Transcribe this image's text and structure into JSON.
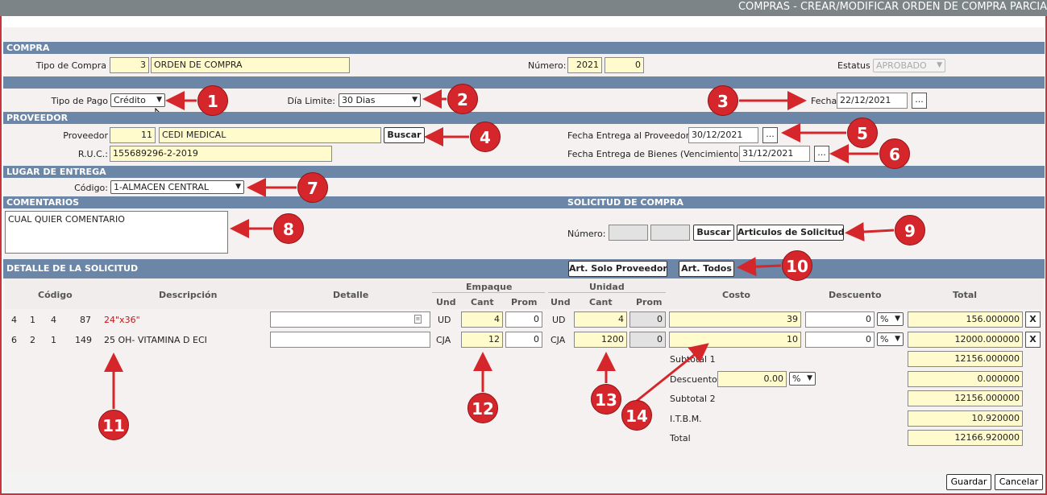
{
  "window": {
    "title": "COMPRAS - CREAR/MODIFICAR ORDEN DE COMPRA PARCIA"
  },
  "compra": {
    "section": "COMPRA",
    "tipo_label": "Tipo de Compra",
    "tipo_code": "3",
    "tipo_name": "ORDEN DE COMPRA",
    "numero_label": "Número:",
    "numero_year": "2021",
    "numero_seq": "0",
    "estatus_label": "Estatus",
    "estatus_value": "APROBADO"
  },
  "pago": {
    "tipo_label": "Tipo de Pago",
    "tipo_value": "Crédito",
    "dia_label": "Día Limite:",
    "dia_value": "30 Dias",
    "fecha_label": "Fecha",
    "fecha_value": "22/12/2021",
    "dots": "..."
  },
  "proveedor": {
    "section": "PROVEEDOR",
    "label": "Proveedor",
    "code": "11",
    "name": "CEDI MEDICAL",
    "buscar": "Buscar",
    "ruc_label": "R.U.C.:",
    "ruc_value": "155689296-2-2019",
    "fe_prov_label": "Fecha Entrega al Proveedor",
    "fe_prov_value": "30/12/2021",
    "fe_bienes_label": "Fecha Entrega de Bienes (Vencimiento)",
    "fe_bienes_value": "31/12/2021"
  },
  "lugar": {
    "section": "LUGAR DE ENTREGA",
    "codigo_label": "Código:",
    "codigo_value": "1-ALMACEN CENTRAL"
  },
  "comentarios": {
    "section": "COMENTARIOS",
    "text": "CUAL QUIER COMENTARIO"
  },
  "solicitud": {
    "section": "SOLICITUD DE COMPRA",
    "numero_label": "Número:",
    "buscar": "Buscar",
    "articulos": "Articulos de Solicitud"
  },
  "detalle": {
    "section": "DETALLE DE LA SOLICITUD",
    "btn_solo": "Art. Solo Proveedor",
    "btn_todos": "Art. Todos",
    "headers": {
      "codigo": "Código",
      "descripcion": "Descripción",
      "detalle": "Detalle",
      "empaque": "Empaque",
      "unidad": "Unidad",
      "und": "Und",
      "cant": "Cant",
      "prom": "Prom",
      "costo": "Costo",
      "descuento": "Descuento",
      "total": "Total"
    },
    "rows": [
      {
        "c1": "4",
        "c2": "1",
        "c3": "4",
        "c4": "87",
        "desc": "24\"x36\"",
        "detalle": "",
        "emp_und": "UD",
        "emp_cant": "4",
        "emp_prom": "0",
        "uni_und": "UD",
        "uni_cant": "4",
        "uni_prom": "0",
        "costo": "39",
        "descuento": "0",
        "desc_type": "%",
        "total": "156.000000",
        "x": "X"
      },
      {
        "c1": "6",
        "c2": "2",
        "c3": "1",
        "c4": "149",
        "desc": "25 OH- VITAMINA D ECI",
        "detalle": "",
        "emp_und": "CJA",
        "emp_cant": "12",
        "emp_prom": "0",
        "uni_und": "CJA",
        "uni_cant": "1200",
        "uni_prom": "0",
        "costo": "10",
        "descuento": "0",
        "desc_type": "%",
        "total": "12000.000000",
        "x": "X"
      }
    ],
    "totals": {
      "subtotal1_label": "Subtotal 1",
      "subtotal1": "12156.000000",
      "descuento_label": "Descuento",
      "descuento_input": "0.00",
      "descuento_type": "%",
      "descuento": "0.000000",
      "subtotal2_label": "Subtotal 2",
      "subtotal2": "12156.000000",
      "itbm_label": "I.T.B.M.",
      "itbm": "10.920000",
      "total_label": "Total",
      "total": "12166.920000"
    }
  },
  "footer": {
    "guardar": "Guardar",
    "cancelar": "Cancelar"
  },
  "annotations": [
    "1",
    "2",
    "3",
    "4",
    "5",
    "6",
    "7",
    "8",
    "9",
    "10",
    "11",
    "12",
    "13",
    "14"
  ],
  "colors": {
    "section_bg": "#6b86a6",
    "field_bg": "#fffbcc",
    "annotation": "#d5262b",
    "frame": "#c7353a"
  }
}
